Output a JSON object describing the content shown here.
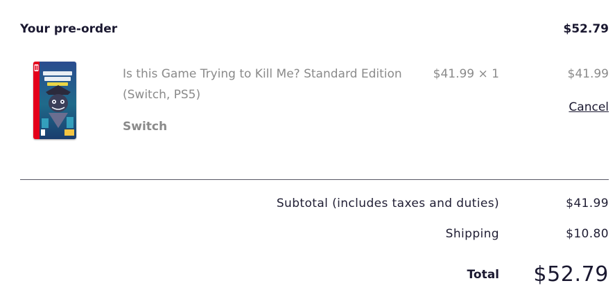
{
  "order": {
    "title": "Your pre-order",
    "header_total": "$52.79"
  },
  "item": {
    "name": "Is this Game Trying to Kill Me? Standard Edition (Switch, PS5)",
    "variant": "Switch",
    "price_qty": "$41.99 × 1",
    "line_total": "$41.99",
    "cancel_label": "Cancel",
    "image_icon": "game-boxart-icon"
  },
  "summary": {
    "subtotal_label": "Subtotal (includes taxes and duties)",
    "subtotal_value": "$41.99",
    "shipping_label": "Shipping",
    "shipping_value": "$10.80",
    "total_label": "Total",
    "total_value": "$52.79"
  },
  "colors": {
    "text_dark": "#1a1830",
    "text_muted": "#8a8a8a",
    "divider": "#555562",
    "boxart_red": "#e4001b",
    "boxart_blue": "#1c3f86"
  }
}
